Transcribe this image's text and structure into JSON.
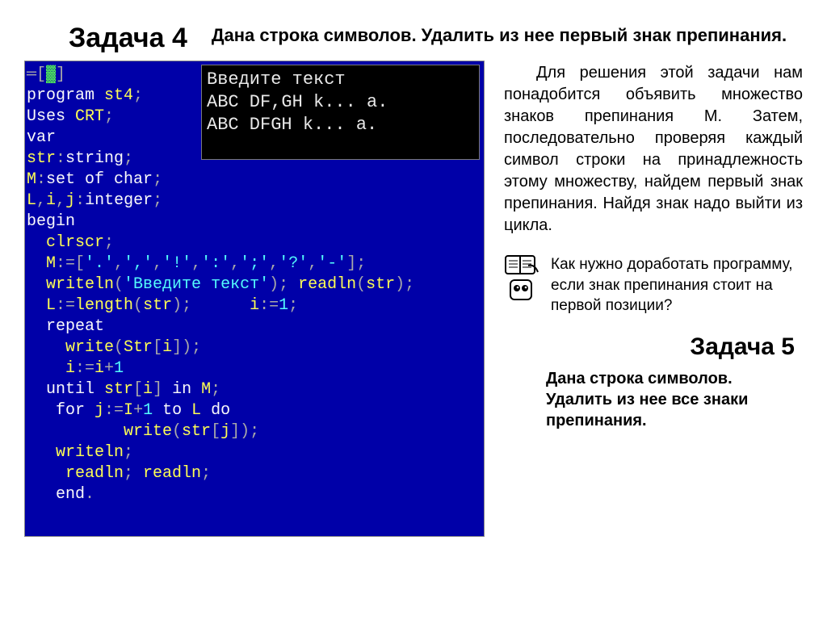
{
  "header": {
    "task_title": "Задача 4",
    "task_desc": "Дана строка символов. Удалить из нее первый знак препинания."
  },
  "output": {
    "line1": "Введите текст",
    "line2": "ABC DF,GH k... a.",
    "line3": "ABC DFGH k... a."
  },
  "code_snippets": {
    "l1a": "═[",
    "l1b": "▓",
    "l1c": "]",
    "l2a": "program ",
    "l2b": "st4",
    "l2c": ";",
    "l3a": "Uses ",
    "l3b": "CRT",
    "l3c": ";",
    "l4": "var",
    "l5a": "str",
    "l5b": ":",
    "l5c": "string",
    "l5d": ";",
    "l6a": "M",
    "l6b": ":",
    "l6c": "set of char",
    "l6d": ";",
    "l7a": "L",
    "l7b": ",",
    "l7c": "i",
    "l7d": ",",
    "l7e": "j",
    "l7f": ":",
    "l7g": "integer",
    "l7h": ";",
    "l8": "begin",
    "l9a": "  clrscr",
    "l9b": ";",
    "l10a": "  M",
    "l10b": ":=[",
    "l10c": "'.'",
    "l10d": ",",
    "l10e": "','",
    "l10f": ",",
    "l10g": "'!'",
    "l10h": ",",
    "l10i": "':'",
    "l10j": ",",
    "l10k": "';'",
    "l10l": ",",
    "l10m": "'?'",
    "l10n": ",",
    "l10o": "'-'",
    "l10p": "];",
    "l11a": "  writeln",
    "l11b": "(",
    "l11c": "'Введите текст'",
    "l11d": "); ",
    "l11e": "readln",
    "l11f": "(",
    "l11g": "str",
    "l11h": ");",
    "l12a": "  L",
    "l12b": ":=",
    "l12c": "length",
    "l12d": "(",
    "l12e": "str",
    "l12f": ");      ",
    "l12g": "i",
    "l12h": ":=",
    "l12i": "1",
    "l12j": ";",
    "l13": "  repeat",
    "l14a": "    write",
    "l14b": "(",
    "l14c": "Str",
    "l14d": "[",
    "l14e": "i",
    "l14f": "]);",
    "l15a": "    i",
    "l15b": ":=",
    "l15c": "i",
    "l15d": "+",
    "l15e": "1",
    "l16a": "  until ",
    "l16b": "str",
    "l16c": "[",
    "l16d": "i",
    "l16e": "]",
    "l16f": " in ",
    "l16g": "M",
    "l16h": ";",
    "l17a": "   for ",
    "l17b": "j",
    "l17c": ":=",
    "l17d": "I",
    "l17e": "+",
    "l17f": "1",
    "l17g": " to ",
    "l17h": "L",
    "l17i": " do",
    "l18a": "          write",
    "l18b": "(",
    "l18c": "str",
    "l18d": "[",
    "l18e": "j",
    "l18f": "]);",
    "l19a": "   writeln",
    "l19b": ";",
    "l20a": "    readln",
    "l20b": "; ",
    "l20c": "readln",
    "l20d": ";",
    "l21a": "   end",
    "l21b": "."
  },
  "explain": "Для решения этой задачи нам понадобится объявить множество знаков препинания M. Затем, последовательно проверяя каждый символ строки на принадлежность этому множеству, найдем первый знак препинания. Найдя знак надо выйти из цикла.",
  "question": "Как нужно доработать программу, если знак препинания стоит на первой позиции?",
  "task5": {
    "title": "Задача 5",
    "desc": "Дана строка символов. Удалить из нее все знаки препинания."
  }
}
